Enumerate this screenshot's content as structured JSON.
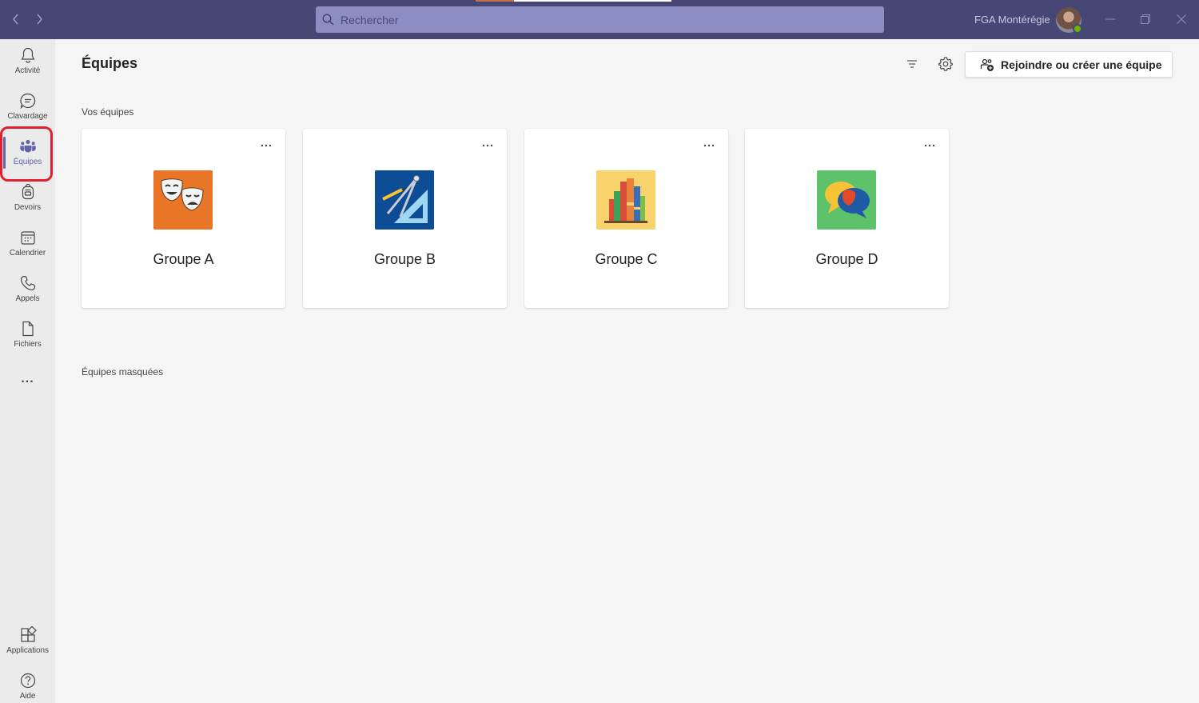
{
  "titlebar": {
    "search_placeholder": "Rechercher",
    "org_name": "FGA Montérégie"
  },
  "appbar": {
    "items": [
      {
        "label": "Activité",
        "icon": "bell-icon"
      },
      {
        "label": "Clavardage",
        "icon": "chat-icon"
      },
      {
        "label": "Équipes",
        "icon": "teams-icon",
        "active": true
      },
      {
        "label": "Devoirs",
        "icon": "backpack-icon"
      },
      {
        "label": "Calendrier",
        "icon": "calendar-icon"
      },
      {
        "label": "Appels",
        "icon": "phone-icon"
      },
      {
        "label": "Fichiers",
        "icon": "file-icon"
      }
    ],
    "more": "...",
    "bottom": [
      {
        "label": "Applications",
        "icon": "apps-icon"
      },
      {
        "label": "Aide",
        "icon": "help-icon"
      }
    ]
  },
  "main": {
    "title": "Équipes",
    "join_button": "Rejoindre ou créer une équipe",
    "your_teams_label": "Vos équipes",
    "hidden_teams_label": "Équipes masquées",
    "teams": [
      {
        "name": "Groupe A",
        "icon": "theater-masks-icon",
        "color": "#e97527"
      },
      {
        "name": "Groupe B",
        "icon": "geometry-tools-icon",
        "color": "#0d4d96"
      },
      {
        "name": "Groupe C",
        "icon": "books-icon",
        "color": "#f8d36c"
      },
      {
        "name": "Groupe D",
        "icon": "speech-bubbles-icon",
        "color": "#5dc26a"
      }
    ]
  },
  "colors": {
    "titlebar": "#464775",
    "accent": "#6264a7",
    "highlight": "#e0202e"
  }
}
